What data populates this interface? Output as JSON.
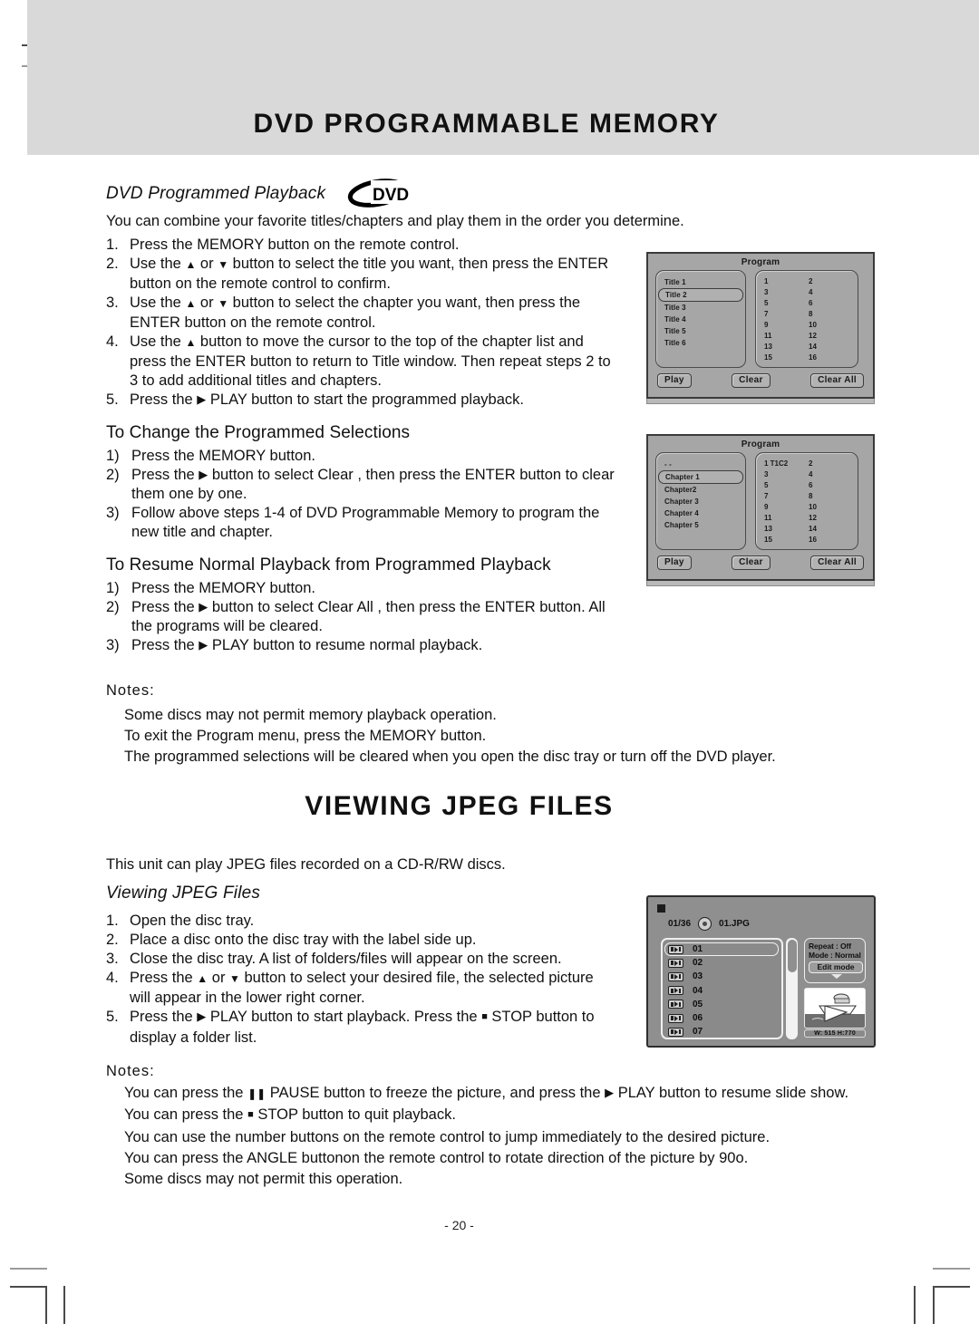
{
  "page": {
    "number": "- 20 -"
  },
  "section1": {
    "banner_title": "DVD PROGRAMMABLE MEMORY",
    "subhead": "DVD Programmed Playback",
    "disc_logo": "dvd-logo",
    "intro": "You can combine your favorite titles/chapters and play them in the order you determine.",
    "steps": [
      {
        "num": "1.",
        "text": "Press the MEMORY button on the remote control."
      },
      {
        "num": "2.",
        "text_a": "Use the ",
        "icon_a": "up",
        "text_b": " or ",
        "icon_b": "down",
        "text_c": " button to select the title you want, then press the ENTER button on the remote control to confirm."
      },
      {
        "num": "3.",
        "text_a": "Use the ",
        "icon_a": "up",
        "text_b": " or ",
        "icon_b": "down",
        "text_c": " button to select the chapter you want, then press the ENTER button on the remote control."
      },
      {
        "num": "4.",
        "text_a": "Use the ",
        "icon_a": "up",
        "text_c": " button to move the cursor to the top of the chapter list and press the ENTER button to return to Title window. Then repeat steps 2 to 3 to add additional titles and chapters."
      },
      {
        "num": "5.",
        "text_a": "Press the ",
        "icon_a": "play",
        "text_c": " PLAY  button to start the programmed playback."
      }
    ],
    "change_head": "To Change the Programmed Selections",
    "change_steps": [
      {
        "num": "1)",
        "text": "Press the MEMORY button."
      },
      {
        "num": "2)",
        "text_a": "Press the ",
        "icon_a": "play",
        "text_c": " button to select  Clear , then press the ENTER button to clear them one by one."
      },
      {
        "num": "3)",
        "text": "Follow above steps 1-4 of DVD Programmable Memory to program the new title and chapter."
      }
    ],
    "resume_head": "To Resume Normal Playback from Programmed Playback",
    "resume_steps": [
      {
        "num": "1)",
        "text": "Press the MEMORY button."
      },
      {
        "num": "2)",
        "text_a": "Press the ",
        "icon_a": "play",
        "text_c": " button to select  Clear All , then press the  ENTER  button. All the programs will be cleared."
      },
      {
        "num": "3)",
        "text_a": "Press the ",
        "icon_a": "play",
        "text_c": " PLAY button to resume normal playback."
      }
    ],
    "notes_label": "Notes:",
    "notes": [
      "Some discs may not permit memory playback operation.",
      "To exit the Program menu, press the MEMORY button.",
      "The programmed selections will be cleared when you open the disc tray or turn off the DVD player."
    ]
  },
  "osd_title_screen": {
    "title": "Program",
    "left_items": [
      "Title 1",
      "Title 2",
      "Title 3",
      "Title 4",
      "Title 5",
      "Title 6"
    ],
    "selected_index": 1,
    "slots": [
      [
        "1",
        "2"
      ],
      [
        "3",
        "4"
      ],
      [
        "5",
        "6"
      ],
      [
        "7",
        "8"
      ],
      [
        "9",
        "10"
      ],
      [
        "11",
        "12"
      ],
      [
        "13",
        "14"
      ],
      [
        "15",
        "16"
      ]
    ],
    "buttons": [
      "Play",
      "Clear",
      "Clear All"
    ]
  },
  "osd_chapter_screen": {
    "title": "Program",
    "left_items": [
      "- -",
      "Chapter 1",
      "Chapter2",
      "Chapter 3",
      "Chapter 4",
      "Chapter 5"
    ],
    "selected_index": 1,
    "slots": [
      [
        "1  T1C2",
        "2"
      ],
      [
        "3",
        "4"
      ],
      [
        "5",
        "6"
      ],
      [
        "7",
        "8"
      ],
      [
        "9",
        "10"
      ],
      [
        "11",
        "12"
      ],
      [
        "13",
        "14"
      ],
      [
        "15",
        "16"
      ]
    ],
    "buttons": [
      "Play",
      "Clear",
      "Clear All"
    ]
  },
  "section2": {
    "banner_title": "VIEWING JPEG FILES",
    "intro": "This unit can play JPEG files recorded on a CD-R/RW discs.",
    "subhead": "Viewing JPEG Files",
    "steps": [
      {
        "num": "1.",
        "text": "Open the disc tray."
      },
      {
        "num": "2.",
        "text": "Place a disc onto the disc tray with the label side up."
      },
      {
        "num": "3.",
        "text": "Close the disc tray. A list of folders/files will appear on the screen."
      },
      {
        "num": "4.",
        "text_a": "Press the ",
        "icon_a": "up",
        "text_b": " or ",
        "icon_b": "down",
        "text_c": " button to select your desired file, the selected picture will appear in the lower right corner."
      },
      {
        "num": "5.",
        "text_a": "Press the ",
        "icon_a": "play",
        "text_b": " PLAY button to start playback. Press the ",
        "icon_b": "stop",
        "text_c": " STOP button to display a folder list."
      }
    ],
    "notes_label": "Notes:",
    "notes": [
      {
        "text_a": "You can press the ",
        "icon_a": "pause",
        "text_b": " PAUSE button to freeze the picture, and press the ",
        "icon_b": "play",
        "text_c": " PLAY button to resume slide show."
      },
      {
        "text_a": "You can press the ",
        "icon_a": "stop",
        "text_c": " STOP button to quit playback."
      },
      {
        "text": "You can use the number buttons on the remote control to jump immediately to the desired picture."
      },
      {
        "text": "You can press the ANGLE buttonon the remote control to rotate direction of the picture by 90o."
      },
      {
        "text": "Some discs may not permit this operation."
      }
    ]
  },
  "osd_jpeg_screen": {
    "stop_icon": "stop-icon",
    "counter": "01/36",
    "disc_icon": "disc-icon",
    "filename": "01.JPG",
    "files": [
      "01",
      "02",
      "03",
      "04",
      "05",
      "06",
      "07"
    ],
    "selected_index": 0,
    "repeat": "Repeat : Off",
    "mode": "Mode   : Normal",
    "edit_mode": "Edit mode",
    "dimensions": "W: 515  H:770"
  },
  "colors": {
    "banner_gray": "#d9d9d9",
    "osd_gray": "#a6a6a6",
    "jpeg_osd_gray": "#8f8f8f",
    "text": "#111111"
  }
}
